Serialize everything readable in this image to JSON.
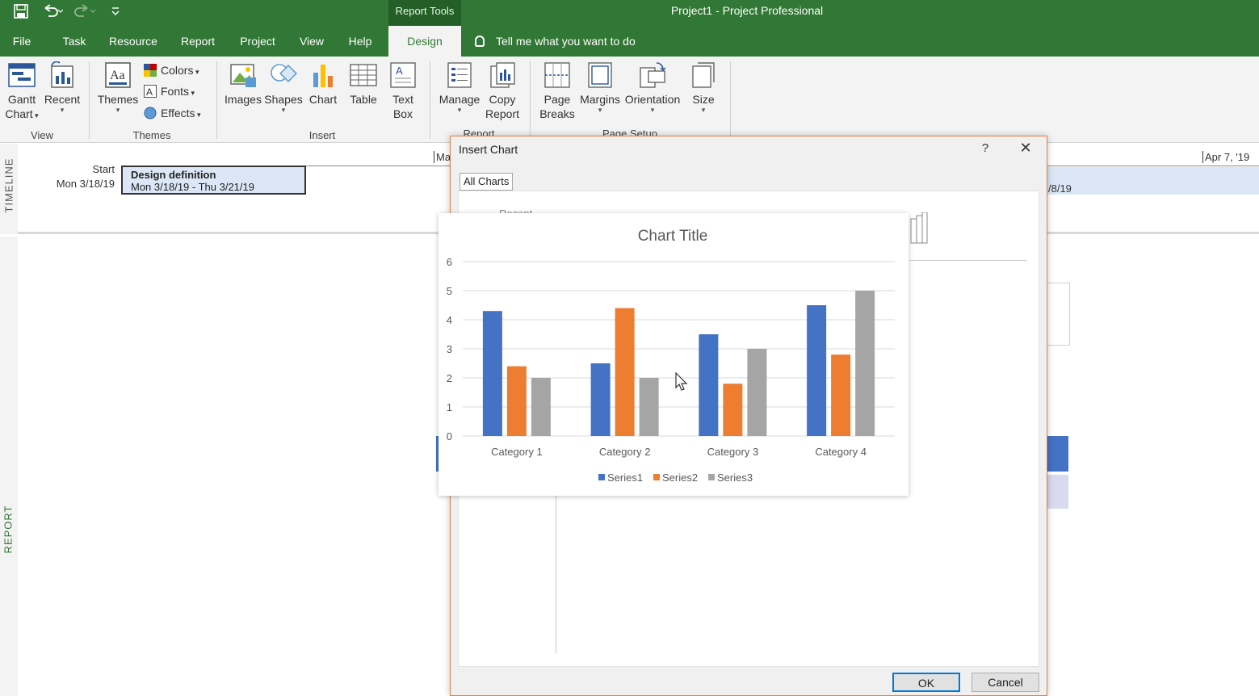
{
  "quick_access": {
    "save_icon": "save-icon",
    "undo_icon": "undo-icon",
    "redo_icon": "redo-icon",
    "customize_icon": "customize-icon"
  },
  "title_bar": {
    "context_tab": "Report Tools",
    "window_title": "Project1  -  Project Professional"
  },
  "tabs": [
    "File",
    "Task",
    "Resource",
    "Report",
    "Project",
    "View",
    "Help",
    "Design"
  ],
  "active_tab": "Design",
  "tell_me": "Tell me what you want to do",
  "ribbon": {
    "view_group": {
      "label": "View",
      "gantt_line1": "Gantt",
      "gantt_line2": "Chart",
      "recent": "Recent"
    },
    "themes_group": {
      "label": "Themes",
      "themes": "Themes",
      "colors": "Colors",
      "fonts": "Fonts",
      "effects": "Effects"
    },
    "insert_group": {
      "label": "Insert",
      "images": "Images",
      "shapes": "Shapes",
      "chart": "Chart",
      "table": "Table",
      "textbox_line1": "Text",
      "textbox_line2": "Box"
    },
    "report_group": {
      "label": "Report",
      "manage": "Manage",
      "copy_line1": "Copy",
      "copy_line2": "Report"
    },
    "page_setup_group": {
      "label": "Page Setup",
      "pagebreaks_line1": "Page",
      "pagebreaks_line2": "Breaks",
      "margins": "Margins",
      "orientation": "Orientation",
      "size": "Size"
    }
  },
  "timeline": {
    "side_label": "TIMELINE",
    "start_label": "Start",
    "start_date": "Mon 3/18/19",
    "task_title": "Design definition",
    "task_dates": "Mon 3/18/19 - Thu 3/21/19",
    "left_tick": "Ma",
    "end_label": "Apr 7, '19",
    "right_partial_date": "/8/19"
  },
  "report": {
    "side_label": "REPORT"
  },
  "dialog": {
    "title": "Insert Chart",
    "help": "?",
    "close": "✕",
    "tab": "All Charts",
    "recent_partial": "Recent",
    "ok": "OK",
    "cancel": "Cancel"
  },
  "colors": {
    "series1": "#4472c4",
    "series2": "#ed7d31",
    "series3": "#a5a5a5",
    "ribbon_green": "#317735",
    "dialog_border": "#e07f45"
  },
  "chart_data": {
    "type": "bar",
    "title": "Chart Title",
    "categories": [
      "Category 1",
      "Category 2",
      "Category 3",
      "Category 4"
    ],
    "series": [
      {
        "name": "Series1",
        "values": [
          4.3,
          2.5,
          3.5,
          4.5
        ]
      },
      {
        "name": "Series2",
        "values": [
          2.4,
          4.4,
          1.8,
          2.8
        ]
      },
      {
        "name": "Series3",
        "values": [
          2,
          2,
          3,
          5
        ]
      }
    ],
    "ylim": [
      0,
      6
    ],
    "yticks": [
      0,
      1,
      2,
      3,
      4,
      5,
      6
    ],
    "grid": true,
    "legend": "bottom"
  }
}
